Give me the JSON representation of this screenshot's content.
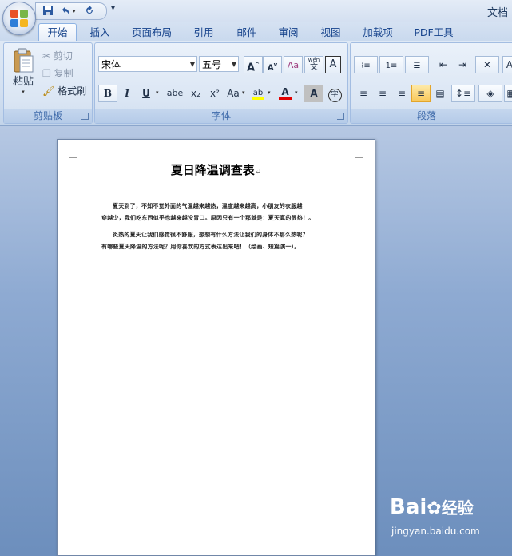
{
  "titlebar": {
    "document_title": "文档",
    "qat_customize": "▾"
  },
  "tabs": [
    {
      "label": "开始",
      "active": true
    },
    {
      "label": "插入"
    },
    {
      "label": "页面布局"
    },
    {
      "label": "引用"
    },
    {
      "label": "邮件"
    },
    {
      "label": "审阅"
    },
    {
      "label": "视图"
    },
    {
      "label": "加载项"
    },
    {
      "label": "PDF工具"
    }
  ],
  "clipboard": {
    "paste": "粘贴",
    "cut": "剪切",
    "copy": "复制",
    "format_painter": "格式刷",
    "group_label": "剪贴板"
  },
  "font": {
    "font_name": "宋体",
    "font_size": "五号",
    "group_label": "字体",
    "bold": "B",
    "italic": "I",
    "underline": "U",
    "strike": "abe",
    "subscript": "x₂",
    "superscript": "x²",
    "change_case": "Aa",
    "grow": "A",
    "shrink": "A",
    "phonetic": "wén",
    "phonetic_char": "文",
    "char_border": "A",
    "highlight": "ab",
    "font_color": "A",
    "char_shading": "A",
    "enclose": "字"
  },
  "paragraph": {
    "group_label": "段落"
  },
  "colors": {
    "accent": "#15428b",
    "highlight_bar": "#ffff00",
    "font_color_bar": "#e00000"
  },
  "document": {
    "title": "夏日降温调查表",
    "paragraph_mark": "↵",
    "para1": [
      "夏天到了，不知不觉外面的气温越来越热，温度越来越高，小朋友的衣服越",
      "穿越少，我们吃东西似乎也越来越没胃口。原因只有一个那就是：夏天真的很热！。"
    ],
    "para2": [
      "炎热的夏天让我们感觉很不舒服，想想有什么方法让我们的身体不那么热呢？",
      "有哪些夏天降温的方法呢？用你喜欢的方式表达出来吧！（绘画、短篇演一）。"
    ]
  },
  "watermark": {
    "brand": "Bai",
    "brand_suffix": "经验",
    "url": "jingyan.baidu.com"
  }
}
